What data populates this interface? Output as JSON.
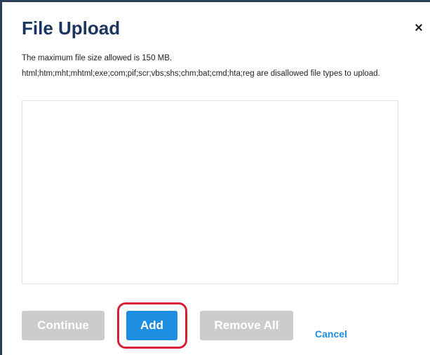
{
  "dialog": {
    "title": "File Upload",
    "close_icon": "×"
  },
  "info": {
    "max_size_text": "The maximum file size allowed is 150 MB.",
    "disallowed_text": "html;htm;mht;mhtml;exe;com;pif;scr;vbs;shs;chm;bat;cmd;hta;reg are disallowed file types to upload."
  },
  "buttons": {
    "continue_label": "Continue",
    "add_label": "Add",
    "remove_all_label": "Remove All",
    "cancel_label": "Cancel"
  },
  "colors": {
    "title": "#1a3560",
    "primary": "#1e8ee0",
    "disabled": "#cccccc",
    "highlight": "#d61f35"
  }
}
